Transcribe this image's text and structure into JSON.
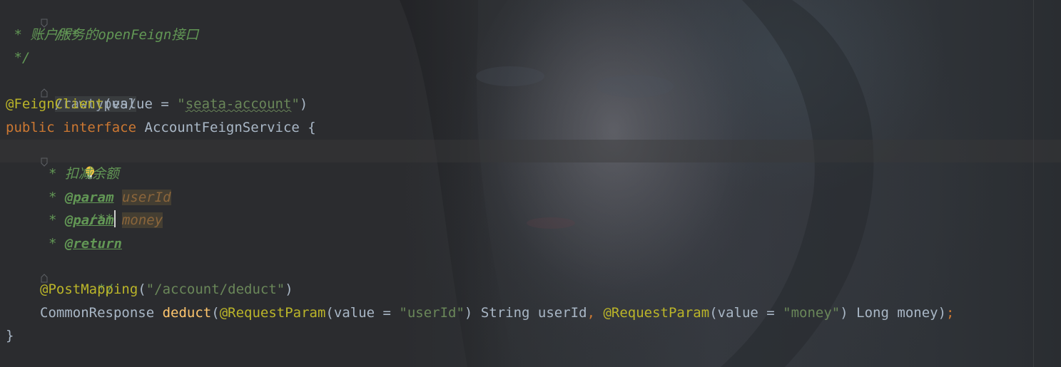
{
  "editor": {
    "lines": [
      {
        "slash_stars": "/**"
      },
      {
        "star": " * ",
        "text": "账户服务的openFeign接口"
      },
      {
        "end": " */"
      },
      {
        "raw": "/rawtypes/"
      },
      {
        "annotation": "@FeignClient",
        "open": "(",
        "key": "value",
        "eq": " = ",
        "quote_open": "\"",
        "string_body": "seata-account",
        "quote_close": "\"",
        "close": ")"
      },
      {
        "kw1": "public",
        "kw2": "interface",
        "name": "AccountFeignService",
        "brace": "{"
      },
      {
        "doc_open": "/**"
      },
      {
        "star": "* ",
        "text": "扣减余额"
      },
      {
        "star": "* ",
        "tag": "@param",
        "param": "userId"
      },
      {
        "star": "* ",
        "tag": "@param",
        "param": "money"
      },
      {
        "star": "* ",
        "tag": "@return"
      },
      {
        "end": "*/"
      },
      {
        "annotation": "@PostMapping",
        "open": "(",
        "string": "\"/account/deduct\"",
        "close": ")"
      },
      {
        "return_type": "CommonResponse",
        "method": "deduct",
        "open": "(",
        "ann1": "@RequestParam",
        "ann1_open": "(",
        "ann1_key": "value",
        "ann1_eq": " = ",
        "ann1_val": "\"userId\"",
        "ann1_close": ")",
        "type1": "String",
        "arg1": "userId",
        "comma": ",",
        "ann2": "@RequestParam",
        "ann2_open": "(",
        "ann2_key": "value",
        "ann2_eq": " = ",
        "ann2_val": "\"money\"",
        "ann2_close": ")",
        "type2": "Long",
        "arg2": "money",
        "close": ")",
        "semicolon": ";"
      },
      {
        "brace": "}"
      }
    ]
  },
  "colors": {
    "background": "#2b2c2f",
    "comment": "#629755",
    "keyword": "#cc7832",
    "annotation": "#bbb529",
    "string": "#6a8759",
    "function": "#ffc66d",
    "text": "#a9b7c6",
    "param": "#8a653b"
  },
  "icons": {
    "fold": "fold-marker-icon",
    "intention": "lightbulb-icon"
  }
}
